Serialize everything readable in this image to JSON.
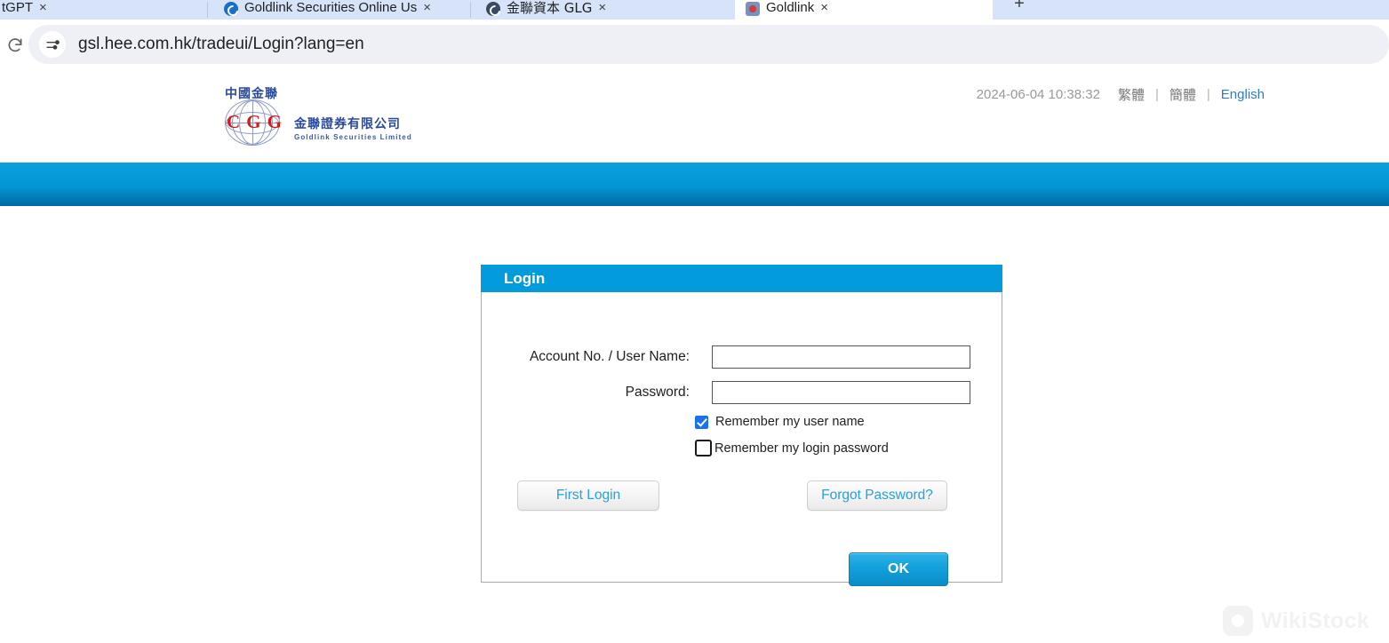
{
  "browser": {
    "tabs": [
      {
        "title": "tGPT",
        "favicon": "none",
        "active": false,
        "close_label": "×"
      },
      {
        "title": "Goldlink Securities Online Us",
        "favicon": "blue-circle-icon",
        "active": false,
        "close_label": "×"
      },
      {
        "title": "金聯資本 GLG",
        "favicon": "dark-circle-icon",
        "active": false,
        "close_label": "×"
      },
      {
        "title": "Goldlink",
        "favicon": "goldlink-logo-icon",
        "active": true,
        "close_label": "×"
      }
    ],
    "new_tab_label": "+",
    "reload_icon": "reload-icon",
    "site_settings_icon": "tune-icon",
    "url": "gsl.hee.com.hk/tradeui/Login?lang=en"
  },
  "site_header": {
    "logo": {
      "cn_top": "中國金聯",
      "mark_letters": [
        "C",
        "G",
        "G"
      ],
      "cn_name": "金聯證券有限公司",
      "en_name": "Goldlink Securities Limited"
    },
    "datetime": "2024-06-04 10:38:32",
    "languages": [
      {
        "label": "繁體",
        "active": false
      },
      {
        "label": "簡體",
        "active": false
      },
      {
        "label": "English",
        "active": true
      }
    ],
    "divider": "|"
  },
  "login": {
    "title": "Login",
    "fields": [
      {
        "label": "Account No. / User Name:",
        "value": "",
        "placeholder": ""
      },
      {
        "label": "Password:",
        "value": "",
        "placeholder": ""
      }
    ],
    "checkboxes": [
      {
        "label": "Remember my user name",
        "checked": true
      },
      {
        "label": "Remember my login password",
        "checked": false
      }
    ],
    "first_login_label": "First Login",
    "forgot_password_label": "Forgot Password?",
    "ok_label": "OK"
  },
  "watermark": {
    "text": "WikiStock"
  },
  "colors": {
    "brand_blue": "#029bdb",
    "nav_blue_top": "#0aa0de",
    "nav_blue_bottom": "#0069a3",
    "link_blue": "#2a9fdb",
    "logo_red": "#d01c1c",
    "logo_navy": "#2b4a9b"
  }
}
